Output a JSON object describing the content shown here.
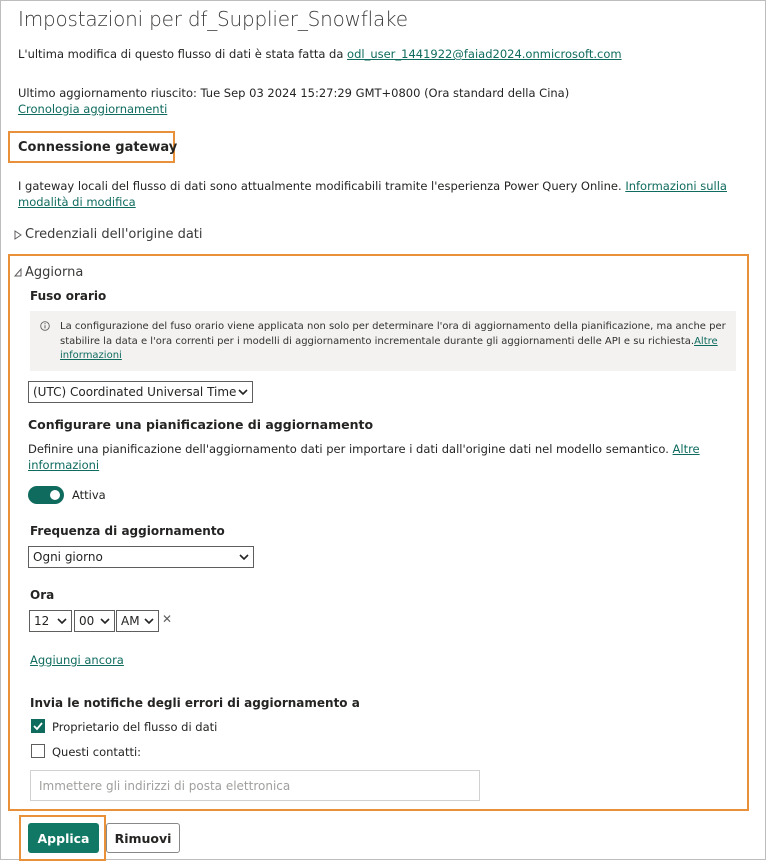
{
  "header": {
    "title": "Impostazioni per df_Supplier_Snowflake",
    "last_modified_prefix": "L'ultima modifica di questo flusso di dati è stata fatta da ",
    "last_modified_user": "odl_user_1441922@faiad2024.onmicrosoft.com",
    "last_refresh": "Ultimo aggiornamento riuscito: Tue Sep 03 2024 15:27:29 GMT+0800 (Ora standard della Cina)",
    "refresh_history_link": "Cronologia aggiornamenti"
  },
  "gateway": {
    "title": "Connessione gateway",
    "desc_line1": "I gateway locali del flusso di dati sono attualmente modificabili tramite l'esperienza Power Query Online. ",
    "link_line1": "Informazioni sulla",
    "link_line2": "modalità di modifica"
  },
  "credentials": {
    "label": "Credenziali dell'origine dati",
    "icon": "caret-right-icon"
  },
  "refresh": {
    "label": "Aggiorna",
    "icon": "caret-down-icon",
    "timezone": {
      "label": "Fuso orario",
      "info_line1": "La configurazione del fuso orario viene applicata non solo per determinare l'ora di aggiornamento della pianificazione, ma anche per",
      "info_line2": "stabilire la data e l'ora correnti per i modelli di aggiornamento incrementale durante gli aggiornamenti delle API e su richiesta.",
      "info_link1": "Altre",
      "info_link2": "informazioni",
      "value": "(UTC) Coordinated Universal Time"
    },
    "schedule": {
      "title": "Configurare una pianificazione di aggiornamento",
      "desc": "Definire una pianificazione dell'aggiornamento dati per importare i dati dall'origine dati nel modello semantico. ",
      "link1": "Altre",
      "link2": "informazioni",
      "toggle_label": "Attiva",
      "toggle_on": true
    },
    "frequency": {
      "label": "Frequenza di aggiornamento",
      "value": "Ogni giorno"
    },
    "time": {
      "label": "Ora",
      "hour": "12",
      "minute": "00",
      "ampm": "AM",
      "remove_glyph": "✕",
      "add_link": "Aggiungi ancora"
    },
    "notifications": {
      "title": "Invia le notifiche degli errori di aggiornamento a",
      "owner_label": "Proprietario del flusso di dati",
      "owner_checked": true,
      "contacts_label": "Questi contatti:",
      "contacts_checked": false,
      "email_placeholder": "Immettere gli indirizzi di posta elettronica"
    }
  },
  "buttons": {
    "apply": "Applica",
    "remove": "Rimuovi"
  },
  "colors": {
    "accent": "#0f6b5e",
    "highlight": "#e8903a",
    "primary_button": "#117865"
  }
}
